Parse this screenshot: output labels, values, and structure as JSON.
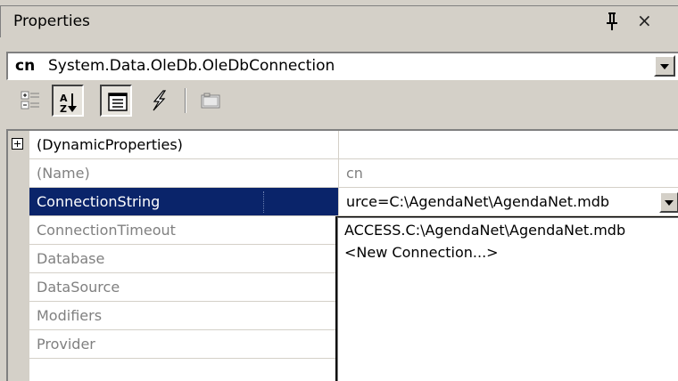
{
  "window": {
    "title": "Properties",
    "pin_icon": "pushpin-icon",
    "close_icon": "close-icon",
    "close_glyph": "×"
  },
  "object_selector": {
    "name": "cn",
    "type": "System.Data.OleDb.OleDbConnection",
    "dropdown_icon": "chevron-down-icon"
  },
  "toolbar": {
    "buttons": [
      {
        "name": "categorized-icon",
        "pressed": false
      },
      {
        "name": "alphabetical-icon",
        "pressed": true
      },
      {
        "name": "properties-icon",
        "pressed": true
      },
      {
        "name": "events-icon",
        "pressed": false
      },
      {
        "name": "property-pages-icon",
        "pressed": false
      }
    ]
  },
  "grid": {
    "rows": [
      {
        "name": "(DynamicProperties)",
        "value": "",
        "expandable": true
      },
      {
        "name": "(Name)",
        "value": "cn"
      },
      {
        "name": "ConnectionString",
        "value": "urce=C:\\AgendaNet\\AgendaNet.mdb",
        "selected": true
      },
      {
        "name": "ConnectionTimeout",
        "value": ""
      },
      {
        "name": "Database",
        "value": ""
      },
      {
        "name": "DataSource",
        "value": ""
      },
      {
        "name": "Modifiers",
        "value": ""
      },
      {
        "name": "Provider",
        "value": ""
      }
    ]
  },
  "dropdown_list": {
    "options": [
      "ACCESS.C:\\AgendaNet\\AgendaNet.mdb",
      "<New Connection...>"
    ]
  },
  "colors": {
    "face": "#d4d0c8",
    "selection": "#0a246a",
    "inactive_text": "#808080"
  }
}
